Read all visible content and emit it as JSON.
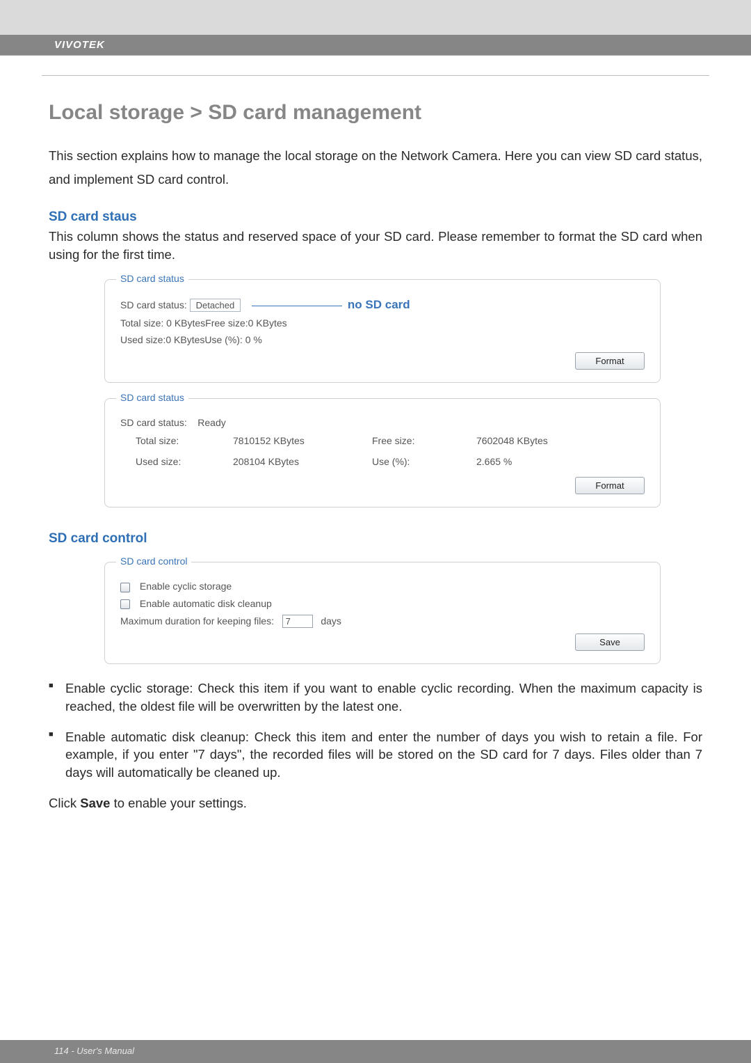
{
  "brand": "VIVOTEK",
  "page_title": "Local storage > SD card management",
  "intro": "This section explains how to manage the local storage on the Network Camera. Here you can view SD card status, and implement SD card control.",
  "section_status_heading": "SD card staus",
  "section_status_desc": "This column shows the status and reserved space of your SD card. Please remember to format the SD card when using for the first time.",
  "panel_status_legend": "SD card status",
  "status1": {
    "label_status": "SD card status:",
    "value_status": "Detached",
    "callout": "no SD card",
    "line_total_free": "Total size: 0  KBytesFree size:0  KBytes",
    "line_used": "Used size:0  KBytesUse (%):  0 %",
    "format_btn": "Format"
  },
  "status2": {
    "label_status": "SD card status:",
    "value_status": "Ready",
    "labels": {
      "total": "Total size:",
      "free": "Free size:",
      "used": "Used size:",
      "usepct": "Use (%):"
    },
    "values": {
      "total": "7810152  KBytes",
      "free": "7602048  KBytes",
      "used": "208104  KBytes",
      "usepct": "2.665 %"
    },
    "format_btn": "Format"
  },
  "section_control_heading": "SD card control",
  "panel_control_legend": "SD card control",
  "control": {
    "cyclic_label": "Enable cyclic storage",
    "cleanup_label": "Enable automatic disk cleanup",
    "max_duration_label": "Maximum duration for keeping files:",
    "days_value": "7",
    "days_suffix": "days",
    "save_btn": "Save"
  },
  "bullets": {
    "cyclic": "Enable cyclic storage: Check this item if you want to enable cyclic recording. When the maximum capacity is reached, the oldest file will be overwritten by the latest one.",
    "cleanup": "Enable automatic disk cleanup: Check this item and enter the number of days you wish to retain a file. For example, if you enter \"7 days\", the recorded files will be stored on the SD card for 7 days. Files older than 7 days will automatically be cleaned up."
  },
  "closing_prefix": "Click ",
  "closing_bold": "Save",
  "closing_suffix": " to enable your settings.",
  "footer": "114 - User's Manual"
}
